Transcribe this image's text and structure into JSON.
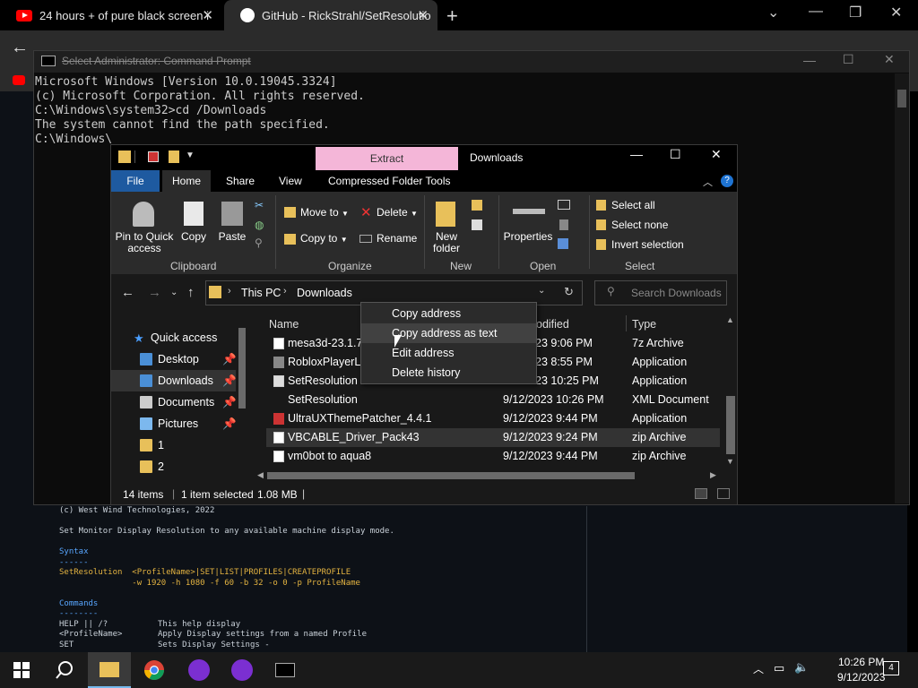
{
  "browser": {
    "tabs": [
      {
        "label": "24 hours + of pure black screen i",
        "icon": "youtube-icon"
      },
      {
        "label": "GitHub - RickStrahl/SetResolutio",
        "icon": "github-icon"
      }
    ],
    "new_tab": "+",
    "window_controls": [
      "⌄",
      "—",
      "❐",
      "✕"
    ]
  },
  "cmd": {
    "title": "Select Administrator: Command Prompt",
    "lines": [
      "Microsoft Windows [Version 10.0.19045.3324]",
      "(c) Microsoft Corporation. All rights reserved.",
      "",
      "C:\\Windows\\system32>cd /Downloads",
      "The system cannot find the path specified.",
      "",
      "C:\\Windows\\"
    ],
    "controls": [
      "—",
      "☐",
      "✕"
    ]
  },
  "explorer": {
    "extract_tab": "Extract",
    "title": "Downloads",
    "controls": [
      "—",
      "☐",
      "✕"
    ],
    "ribbon_tabs": [
      "File",
      "Home",
      "Share",
      "View",
      "Compressed Folder Tools"
    ],
    "ribbon": {
      "pin": "Pin to Quick access",
      "copy": "Copy",
      "paste": "Paste",
      "move_to": "Move to",
      "delete": "Delete",
      "copy_to": "Copy to",
      "rename": "Rename",
      "new_folder": "New folder",
      "properties": "Properties",
      "select_all": "Select all",
      "select_none": "Select none",
      "invert_selection": "Invert selection",
      "groups": [
        "Clipboard",
        "Organize",
        "New",
        "Open",
        "Select"
      ]
    },
    "address": {
      "path": [
        "This PC",
        "Downloads"
      ],
      "search_placeholder": "Search Downloads"
    },
    "nav": {
      "quick_access": "Quick access",
      "items": [
        "Desktop",
        "Downloads",
        "Documents",
        "Pictures",
        "1",
        "2"
      ]
    },
    "columns": {
      "name": "Name",
      "modified": "odified",
      "type": "Type"
    },
    "files": [
      {
        "name": "mesa3d-23.1.7-",
        "date": "23 9:06 PM",
        "type": "7z Archive"
      },
      {
        "name": "RobloxPlayerLa",
        "date": "23 8:55 PM",
        "type": "Application"
      },
      {
        "name": "SetResolution",
        "date": "23 10:25 PM",
        "type": "Application"
      },
      {
        "name": "SetResolution",
        "date": "9/12/2023 10:26 PM",
        "type": "XML Document"
      },
      {
        "name": "UltraUXThemePatcher_4.4.1",
        "date": "9/12/2023 9:44 PM",
        "type": "Application"
      },
      {
        "name": "VBCABLE_Driver_Pack43",
        "date": "9/12/2023 9:24 PM",
        "type": "zip Archive"
      },
      {
        "name": "vm0bot to aqua8",
        "date": "9/12/2023 9:44 PM",
        "type": "zip Archive"
      }
    ],
    "status": {
      "items": "14 items",
      "selected": "1 item selected",
      "size": "1.08 MB"
    }
  },
  "context_menu": [
    "Copy address",
    "Copy address as text",
    "Edit address",
    "Delete history"
  ],
  "readme": {
    "copyright": "(c) West Wind Technologies, 2022",
    "desc": "Set Monitor Display Resolution to any available machine display mode.",
    "syntax_h": "Syntax",
    "syntax_u": "------",
    "syntax_cmd": "SetResolution",
    "syntax_args1": "<ProfileName>|SET|LIST|PROFILES|CREATEPROFILE",
    "syntax_args2": "-w 1920 -h 1080 -f 60 -b 32 -o 0 -p ProfileName",
    "commands_h": "Commands",
    "commands_u": "--------",
    "cmd_rows": [
      {
        "k": "HELP || /?",
        "v": "This help display"
      },
      {
        "k": "<ProfileName>",
        "v": "Apply Display settings from a named Profile"
      },
      {
        "k": "SET",
        "v": "Sets Display Settings -"
      }
    ]
  },
  "taskbar": {
    "time": "10:26 PM",
    "date": "9/12/2023",
    "notifications": "4"
  }
}
